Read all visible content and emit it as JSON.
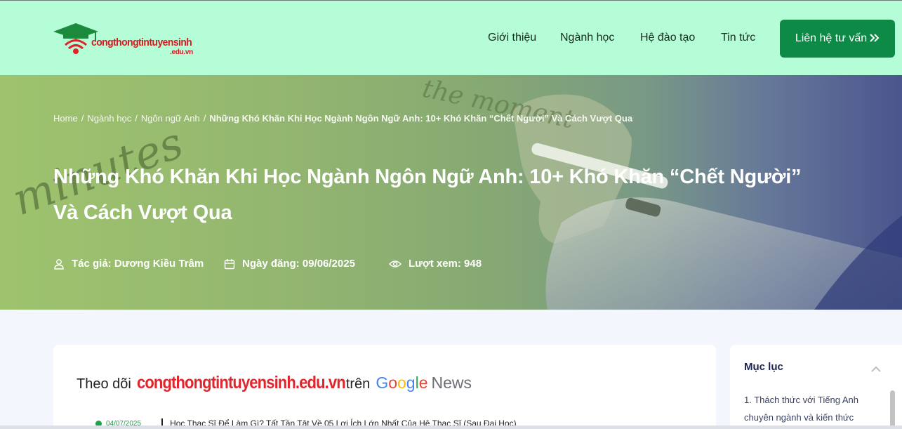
{
  "header": {
    "logo_text": "congthongtintuyensinh",
    "logo_sub": ".edu.vn",
    "nav": [
      {
        "label": "Giới thiệu"
      },
      {
        "label": "Ngành học"
      },
      {
        "label": "Hệ đào tạo"
      },
      {
        "label": "Tin tức"
      }
    ],
    "cta_label": "Liên hệ tư vấn",
    "cta_icon": "double-chevron-right-icon"
  },
  "breadcrumb": {
    "items": [
      "Home",
      "Ngành học",
      "Ngôn ngữ Anh"
    ],
    "separator": "/",
    "current": "Những Khó Khăn Khi Học Ngành Ngôn Ngữ Anh: 10+ Khó Khăn “Chết Người” Và Cách Vượt Qua"
  },
  "article": {
    "title_line1": "Những Khó Khăn Khi Học Ngành Ngôn Ngữ Anh: 10+ Khó Khăn “Chết Người”",
    "title_line2": "Và Cách Vượt Qua",
    "author": "Tác giả: Dương Kiều Trâm",
    "date": "Ngày đăng: 09/06/2025",
    "views": "Lượt xem: 948",
    "hero_handwriting": [
      "minutes",
      "the moment"
    ]
  },
  "follow": {
    "prefix": "Theo dõi",
    "brand": "congthongtintuyensinh.edu.vn",
    "middle": "trên",
    "google": [
      "G",
      "o",
      "o",
      "g",
      "l",
      "e"
    ],
    "news": "News"
  },
  "news_item": {
    "date": "04/07/2025",
    "title": "Học Thạc Sĩ Để Làm Gì? Tất Tần Tật Về 05 Lợi Ích Lớn Nhất Của Hệ Thạc Sĩ (Sau Đại Học)"
  },
  "toc": {
    "title": "Mục lục",
    "first_item": "1. Thách thức với Tiếng Anh chuyên ngành và kiến thức"
  },
  "colors": {
    "header_bg": "#b5fdd6",
    "cta_bg": "#0d8a46",
    "brand_red": "#d71920",
    "hero_green": "#9ec36d",
    "page_bg": "#f3f6fc"
  }
}
